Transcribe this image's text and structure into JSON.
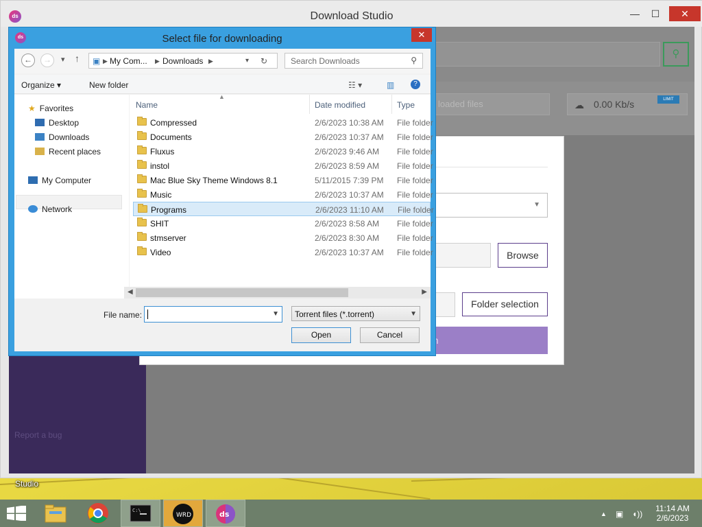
{
  "app": {
    "title": "Download Studio",
    "logo": "ds",
    "minimize": "—",
    "maximize": "☐",
    "close": "✕",
    "search_icon": "magnifier-icon",
    "downloaded_files_label": "loaded files",
    "speed": "0.00 Kb/s",
    "speed_badge": "LIMIT",
    "report_bug": "Report a bug"
  },
  "modal": {
    "browse_label": "Browse",
    "folder_selection_label": "Folder selection",
    "confirm_label": "Confirm"
  },
  "dialog": {
    "title": "Select file for downloading",
    "logo": "ds",
    "close": "✕",
    "address": [
      "My Com...",
      "Downloads"
    ],
    "search_placeholder": "Search Downloads",
    "toolbar": {
      "organize": "Organize",
      "new_folder": "New folder"
    },
    "nav": {
      "favorites": "Favorites",
      "desktop": "Desktop",
      "downloads": "Downloads",
      "recent_places": "Recent places",
      "my_computer": "My Computer",
      "network": "Network"
    },
    "columns": {
      "name": "Name",
      "date": "Date modified",
      "type": "Type"
    },
    "files": [
      {
        "name": "Compressed",
        "date": "2/6/2023 10:38 AM",
        "type": "File folder"
      },
      {
        "name": "Documents",
        "date": "2/6/2023 10:37 AM",
        "type": "File folder"
      },
      {
        "name": "Fluxus",
        "date": "2/6/2023 9:46 AM",
        "type": "File folder"
      },
      {
        "name": "instol",
        "date": "2/6/2023 8:59 AM",
        "type": "File folder"
      },
      {
        "name": "Mac Blue Sky Theme Windows 8.1",
        "date": "5/11/2015 7:39 PM",
        "type": "File folder"
      },
      {
        "name": "Music",
        "date": "2/6/2023 10:37 AM",
        "type": "File folder"
      },
      {
        "name": "Programs",
        "date": "2/6/2023 11:10 AM",
        "type": "File folder"
      },
      {
        "name": "SHIT",
        "date": "2/6/2023 8:58 AM",
        "type": "File folder"
      },
      {
        "name": "stmserver",
        "date": "2/6/2023 8:30 AM",
        "type": "File folder"
      },
      {
        "name": "Video",
        "date": "2/6/2023 10:37 AM",
        "type": "File folder"
      }
    ],
    "selected_file": "Programs",
    "file_name_label": "File name:",
    "file_name_value": "",
    "file_type": "Torrent files (*.torrent)",
    "open_label": "Open",
    "cancel_label": "Cancel"
  },
  "desktop": {
    "label": "Studio"
  },
  "taskbar": {
    "clock_time": "11:14 AM",
    "clock_date": "2/6/2023"
  }
}
